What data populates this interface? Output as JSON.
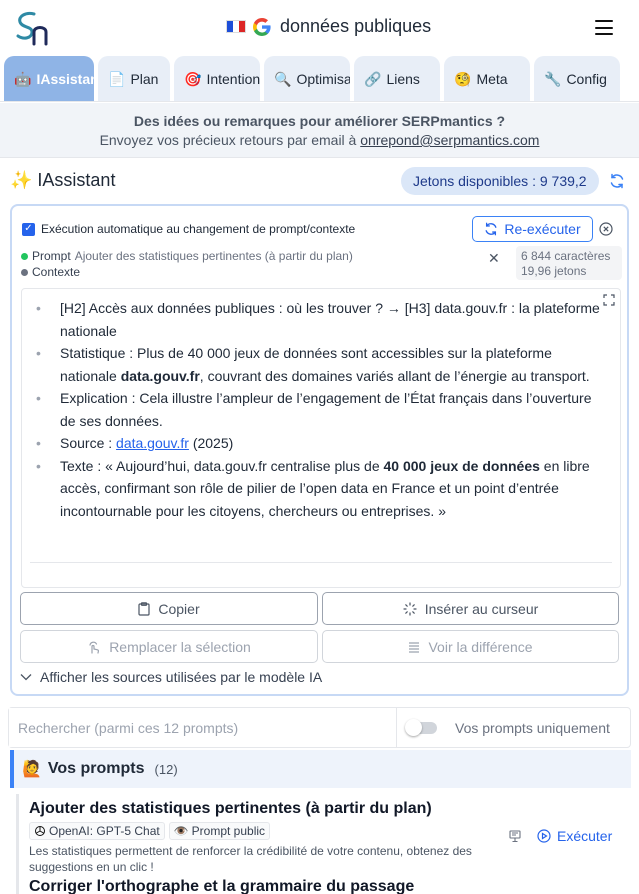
{
  "header": {
    "title": "données publiques",
    "logo_icon": "serpmantics-logo-icon",
    "colors": {
      "brand": "#2f8aa5",
      "accent": "#3b82f6"
    }
  },
  "tabs": [
    {
      "icon": "🤖",
      "label": "IAssistant"
    },
    {
      "icon": "📄",
      "label": "Plan"
    },
    {
      "icon": "🎯",
      "label": "Intention"
    },
    {
      "icon": "🔍",
      "label": "Optimisation"
    },
    {
      "icon": "🔗",
      "label": "Liens"
    },
    {
      "icon": "🧐",
      "label": "Meta"
    },
    {
      "icon": "🔧",
      "label": "Config"
    }
  ],
  "banner": {
    "line1": "Des idées ou remarques pour améliorer SERPmantics ?",
    "line2_prefix": "Envoyez vos précieux retours par email à ",
    "email": "onrepond@serpmantics.com"
  },
  "assistant": {
    "title": "✨ IAssistant",
    "tokens": "Jetons disponibles : 9 739,2",
    "auto_label": "Exécution automatique au changement de prompt/contexte",
    "rerun_label": "Re-exécuter",
    "prompt_label": "Prompt",
    "prompt_value": "Ajouter des statistiques pertinentes (à partir du plan)",
    "context_label": "Contexte",
    "chars": "6 844 caractères",
    "tokens_used": "19,96 jetons",
    "bullets": {
      "b1": "[H2] Accès aux données publiques : où les trouver ? → [H3] data.gouv.fr : la plateforme nationale",
      "b2_pre": "Statistique : Plus de 40 000 jeux de données sont accessibles sur la plateforme nationale ",
      "b2_bold": "data.gouv.fr",
      "b2_post": ", couvrant des domaines variés allant de l’énergie au transport.",
      "b3": "Explication : Cela illustre l’ampleur de l’engagement de l’État français dans l’ouverture de ses données.",
      "b4_pre": "Source : ",
      "b4_link": "data.gouv.fr",
      "b4_post": " (2025)",
      "b5_pre": "Texte : « Aujourd’hui, data.gouv.fr centralise plus de ",
      "b5_bold": "40 000 jeux de données",
      "b5_post": " en libre accès, confirmant son rôle de pilier de l’open data en France et un point d’entrée incontournable pour les citoyens, chercheurs ou entreprises. »"
    },
    "buttons": {
      "copy": "Copier",
      "insert": "Insérer au curseur",
      "replace": "Remplacer la sélection",
      "diff": "Voir la différence"
    },
    "sources_label": "Afficher les sources utilisées par le modèle IA"
  },
  "search": {
    "placeholder": "Rechercher (parmi ces 12 prompts)",
    "toggle_label": "Vos prompts uniquement"
  },
  "prompts_section": {
    "title": "Vos prompts",
    "count": "(12)",
    "items": [
      {
        "title": "Ajouter des statistiques pertinentes (à partir du plan)",
        "model": "OpenAI: GPT-5 Chat",
        "visibility": "Prompt public",
        "description": "Les statistiques permettent de renforcer la crédibilité de votre contenu, obtenez des suggestions en un clic !",
        "action": "Exécuter"
      },
      {
        "title": "Corriger l'orthographe et la grammaire du passage"
      }
    ]
  }
}
